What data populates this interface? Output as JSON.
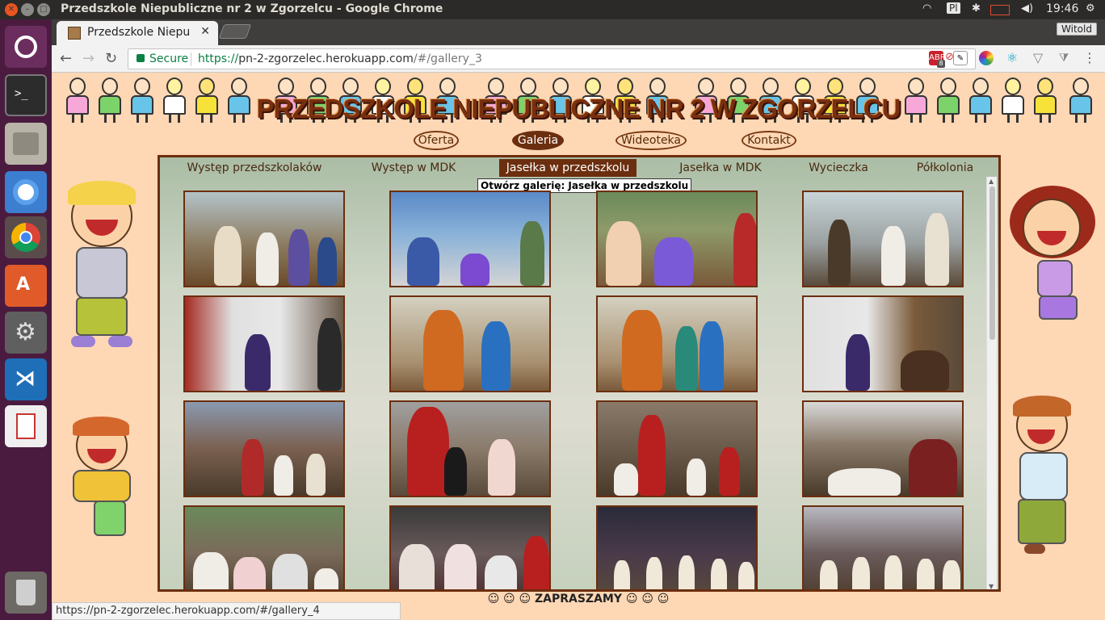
{
  "window": {
    "title": "Przedszkole Niepubliczne nr 2 w Zgorzelcu - Google Chrome",
    "clock": "19:46",
    "keyboard_layout": "Pl",
    "user_button": "Witold"
  },
  "browser": {
    "tab_title": "Przedszkole Niepu",
    "secure_label": "Secure",
    "url_scheme": "https://",
    "url_host": "pn-2-zgorzelec.herokuapp.com",
    "url_rest": "/#/gallery_3",
    "abp_badge": "8",
    "status_url": "https://pn-2-zgorzelec.herokuapp.com/#/gallery_4"
  },
  "site": {
    "title": "PRZEDSZKOLE NIEPUBLICZNE NR 2 W ZGORZELCU",
    "nav": [
      {
        "label": "Oferta",
        "active": false
      },
      {
        "label": "Galeria",
        "active": true
      },
      {
        "label": "Wideoteka",
        "active": false
      },
      {
        "label": "Kontakt",
        "active": false
      }
    ],
    "gallery_tabs": [
      {
        "label": "Występ przedszkolaków",
        "active": false
      },
      {
        "label": "Występ w MDK",
        "active": false
      },
      {
        "label": "Jasełka w przedszkolu",
        "active": true
      },
      {
        "label": "Jasełka w MDK",
        "active": false
      },
      {
        "label": "Wycieczka",
        "active": false
      },
      {
        "label": "Półkolonia",
        "active": false
      }
    ],
    "tooltip": "Otwórz galerię: Jasełka w przedszkolu",
    "footer": "☺ ☺ ☺  ZAPRASZAMY  ☺ ☺ ☺"
  },
  "colors": {
    "page_bg": "#fed7b5",
    "accent_brown": "#6b2e0e",
    "launcher_bg": "#4a1b3f"
  }
}
